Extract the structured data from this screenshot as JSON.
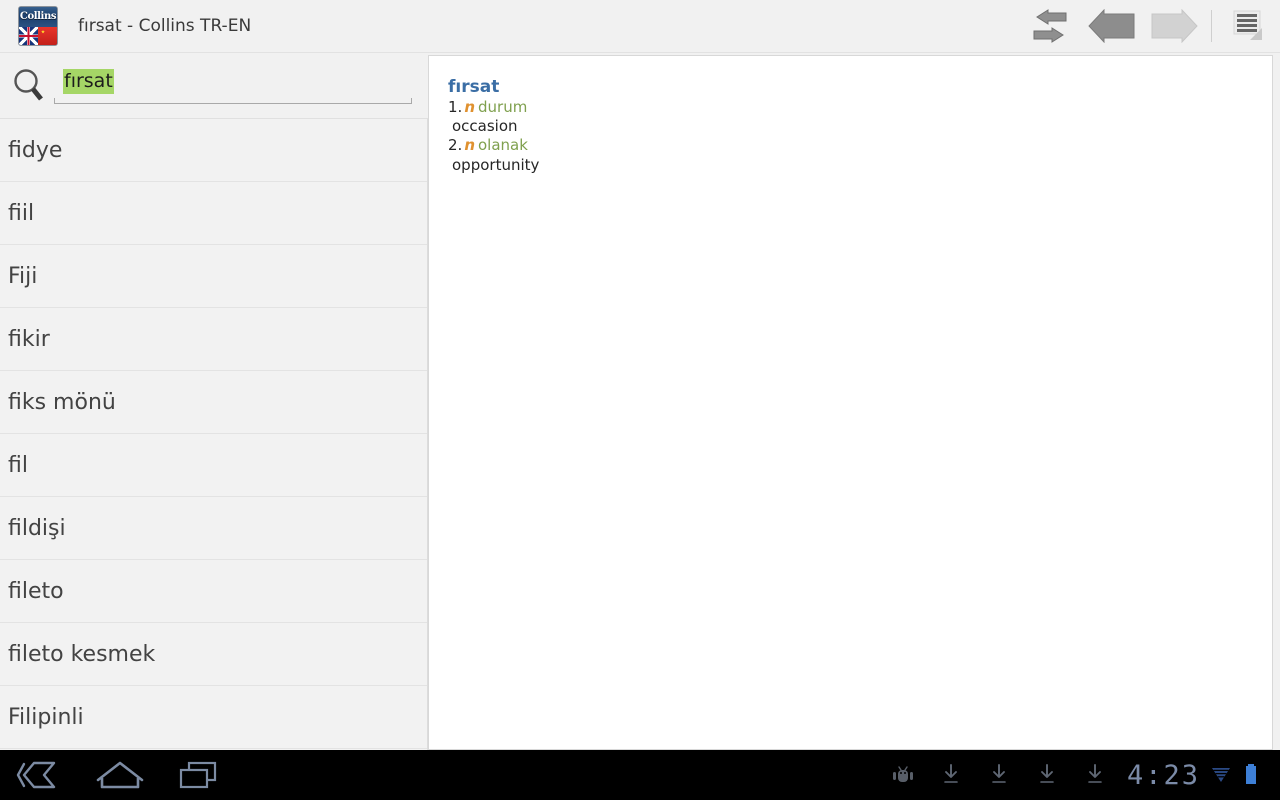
{
  "titlebar": {
    "app_icon_label": "Collins",
    "title": "fırsat - Collins TR-EN",
    "actions": [
      {
        "name": "swap-languages",
        "label": "Swap languages"
      },
      {
        "name": "back",
        "label": "Back"
      },
      {
        "name": "forward",
        "label": "Forward"
      },
      {
        "name": "menu",
        "label": "Menu"
      }
    ]
  },
  "search": {
    "icon": "search-icon",
    "value": "fırsat",
    "placeholder": "",
    "selection_color": "#a5d666"
  },
  "wordlist": {
    "items": [
      {
        "label": "fidye"
      },
      {
        "label": "fiil"
      },
      {
        "label": "Fiji"
      },
      {
        "label": "fikir"
      },
      {
        "label": "fiks mönü"
      },
      {
        "label": "fil"
      },
      {
        "label": "fildişi"
      },
      {
        "label": "fileto"
      },
      {
        "label": "fileto kesmek"
      },
      {
        "label": "Filipinli"
      }
    ]
  },
  "definition": {
    "headword": "fırsat",
    "headword_color": "#3b6ea5",
    "pos_color": "#e0912f",
    "synonym_color": "#7fa04e",
    "senses": [
      {
        "num": "1.",
        "pos": "n",
        "synonym": "durum",
        "translation": "occasion"
      },
      {
        "num": "2.",
        "pos": "n",
        "synonym": "olanak",
        "translation": "opportunity"
      }
    ]
  },
  "systembar": {
    "nav": [
      {
        "name": "back",
        "label": "Back"
      },
      {
        "name": "home",
        "label": "Home"
      },
      {
        "name": "recents",
        "label": "Recent apps"
      }
    ],
    "status_icons": [
      {
        "name": "android-debug-icon"
      },
      {
        "name": "download-icon"
      },
      {
        "name": "download-icon"
      },
      {
        "name": "download-icon"
      },
      {
        "name": "download-icon"
      }
    ],
    "clock": "4:23",
    "signal": "wifi-icon",
    "battery": "battery-icon"
  }
}
